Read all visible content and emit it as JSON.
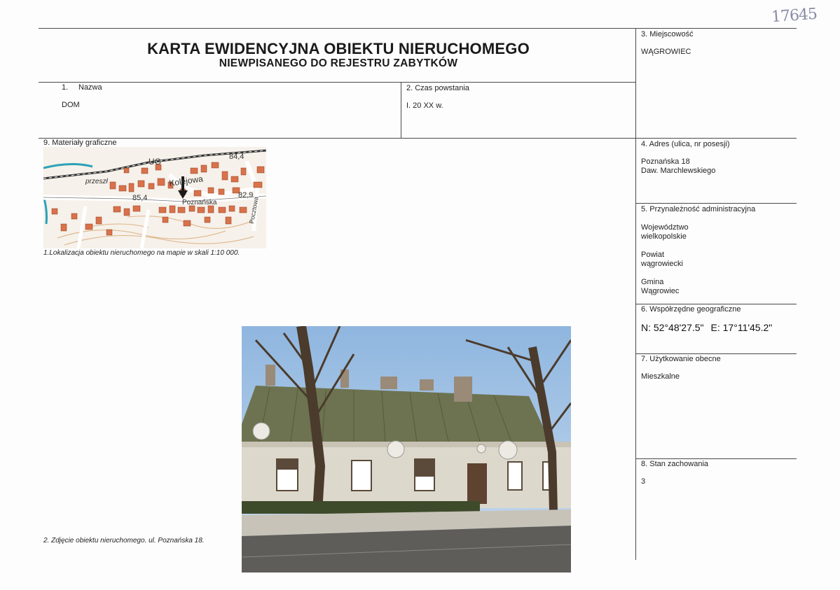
{
  "handwritten_number": "17645",
  "title": {
    "line1": "KARTA EWIDENCYJNA OBIEKTU NIERUCHOMEGO",
    "line2": "NIEWPISANEGO DO REJESTRU ZABYTKÓW"
  },
  "fields": {
    "nazwa": {
      "number": "1.",
      "label": "Nazwa",
      "value": "DOM"
    },
    "czas_powstania": {
      "label": "2. Czas powstania",
      "value": "I. 20 XX w."
    },
    "miejscowosc": {
      "label": "3. Miejscowość",
      "value": "WĄGROWIEC"
    },
    "adres": {
      "label": "4. Adres (ulica, nr posesji)",
      "line1": "Poznańska 18",
      "line2": "Daw. Marchlewskiego"
    },
    "przynaleznosc": {
      "label": "5. Przynależność administracyjna",
      "wojewodztwo_label": "Województwo",
      "wojewodztwo": "wielkopolskie",
      "powiat_label": "Powiat",
      "powiat": "wągrowiecki",
      "gmina_label": "Gmina",
      "gmina": "Wągrowiec"
    },
    "wspolrzedne": {
      "label": "6. Współrzędne geograficzne",
      "n": "N: 52°48'27.5\"",
      "e": "E: 17°11'45.2\""
    },
    "uzytkowanie": {
      "label": "7. Użytkowanie obecne",
      "value": "Mieszkalne"
    },
    "stan": {
      "label": "8. Stan zachowania",
      "value": "3"
    },
    "materialy": {
      "label": "9. Materiały graficzne"
    }
  },
  "map": {
    "labels": [
      "UG",
      "84,4",
      "przeszł",
      "Kolejowa",
      "85,4",
      "Poznańska",
      "82,9",
      "Pocztowa"
    ],
    "caption": "1.Lokalizacja obiektu nieruchomego na mapie w skali 1:10 000."
  },
  "photo": {
    "caption": "2. Zdjęcie obiektu nieruchomego. ul. Poznańska 18."
  }
}
